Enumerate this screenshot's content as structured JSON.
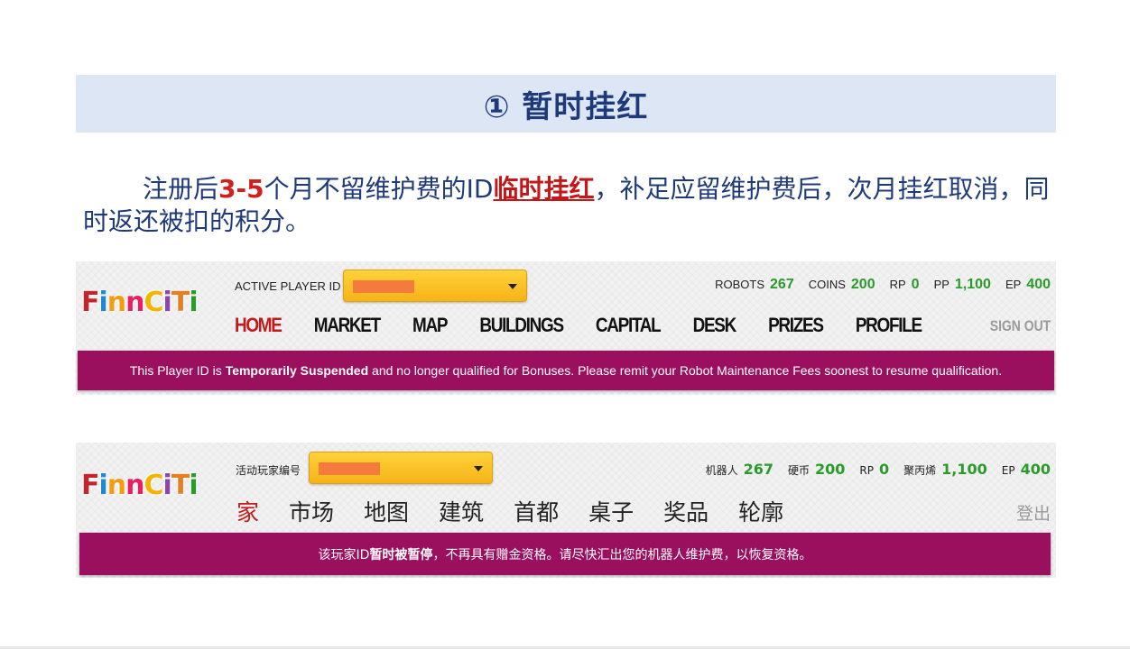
{
  "slide": {
    "title": "① 暂时挂红",
    "desc": {
      "p1": "注册后",
      "red1": "3-5",
      "p2": "个月不留维护费的ID",
      "red2": "临时挂红",
      "p3": "，补足应留维护费后，次月挂红取消，同时返还被扣的积分。"
    }
  },
  "logo": {
    "letters": [
      "F",
      "i",
      "n",
      "n",
      "C",
      "i",
      "T",
      "i"
    ],
    "colors": [
      "#c0262b",
      "#1e88d0",
      "#f39c12",
      "#e91e63",
      "#f4b400",
      "#8e44ad",
      "#e67e22",
      "#2a9b2a"
    ]
  },
  "panel_en": {
    "player_id_label": "ACTIVE PLAYER ID",
    "stats": [
      {
        "label": "ROBOTS",
        "value": "267"
      },
      {
        "label": "COINS",
        "value": "200"
      },
      {
        "label": "RP",
        "value": "0"
      },
      {
        "label": "PP",
        "value": "1,100"
      },
      {
        "label": "EP",
        "value": "400"
      }
    ],
    "nav": [
      "HOME",
      "MARKET",
      "MAP",
      "BUILDINGS",
      "CAPITAL",
      "DESK",
      "PRIZES",
      "PROFILE"
    ],
    "signout": "SIGN OUT",
    "banner": {
      "pre": "This Player ID is ",
      "bold": "Temporarily Suspended",
      "post": " and no longer qualified for Bonuses. Please remit your Robot Maintenance Fees soonest to resume qualification."
    }
  },
  "panel_cn": {
    "player_id_label": "活动玩家编号",
    "stats": [
      {
        "label": "机器人",
        "value": "267"
      },
      {
        "label": "硬币",
        "value": "200"
      },
      {
        "label": "RP",
        "value": "0"
      },
      {
        "label": "聚丙烯",
        "value": "1,100"
      },
      {
        "label": "EP",
        "value": "400"
      }
    ],
    "nav": [
      "家",
      "市场",
      "地图",
      "建筑",
      "首都",
      "桌子",
      "奖品",
      "轮廓"
    ],
    "signout": "登出",
    "banner": {
      "pre": "该玩家ID",
      "bold": "暂时被暂停",
      "post": "，不再具有赠金资格。请尽快汇出您的机器人维护费，以恢复资格。"
    }
  },
  "colors": {
    "header_bg": "#dce6f4",
    "title_blue": "#1f3a7a",
    "highlight_red": "#d41d1d",
    "banner_magenta": "#9b0f5f",
    "stat_green": "#2a9b2a",
    "dropdown_yellow": "#f5b318",
    "redaction_orange": "#f57a3d"
  }
}
